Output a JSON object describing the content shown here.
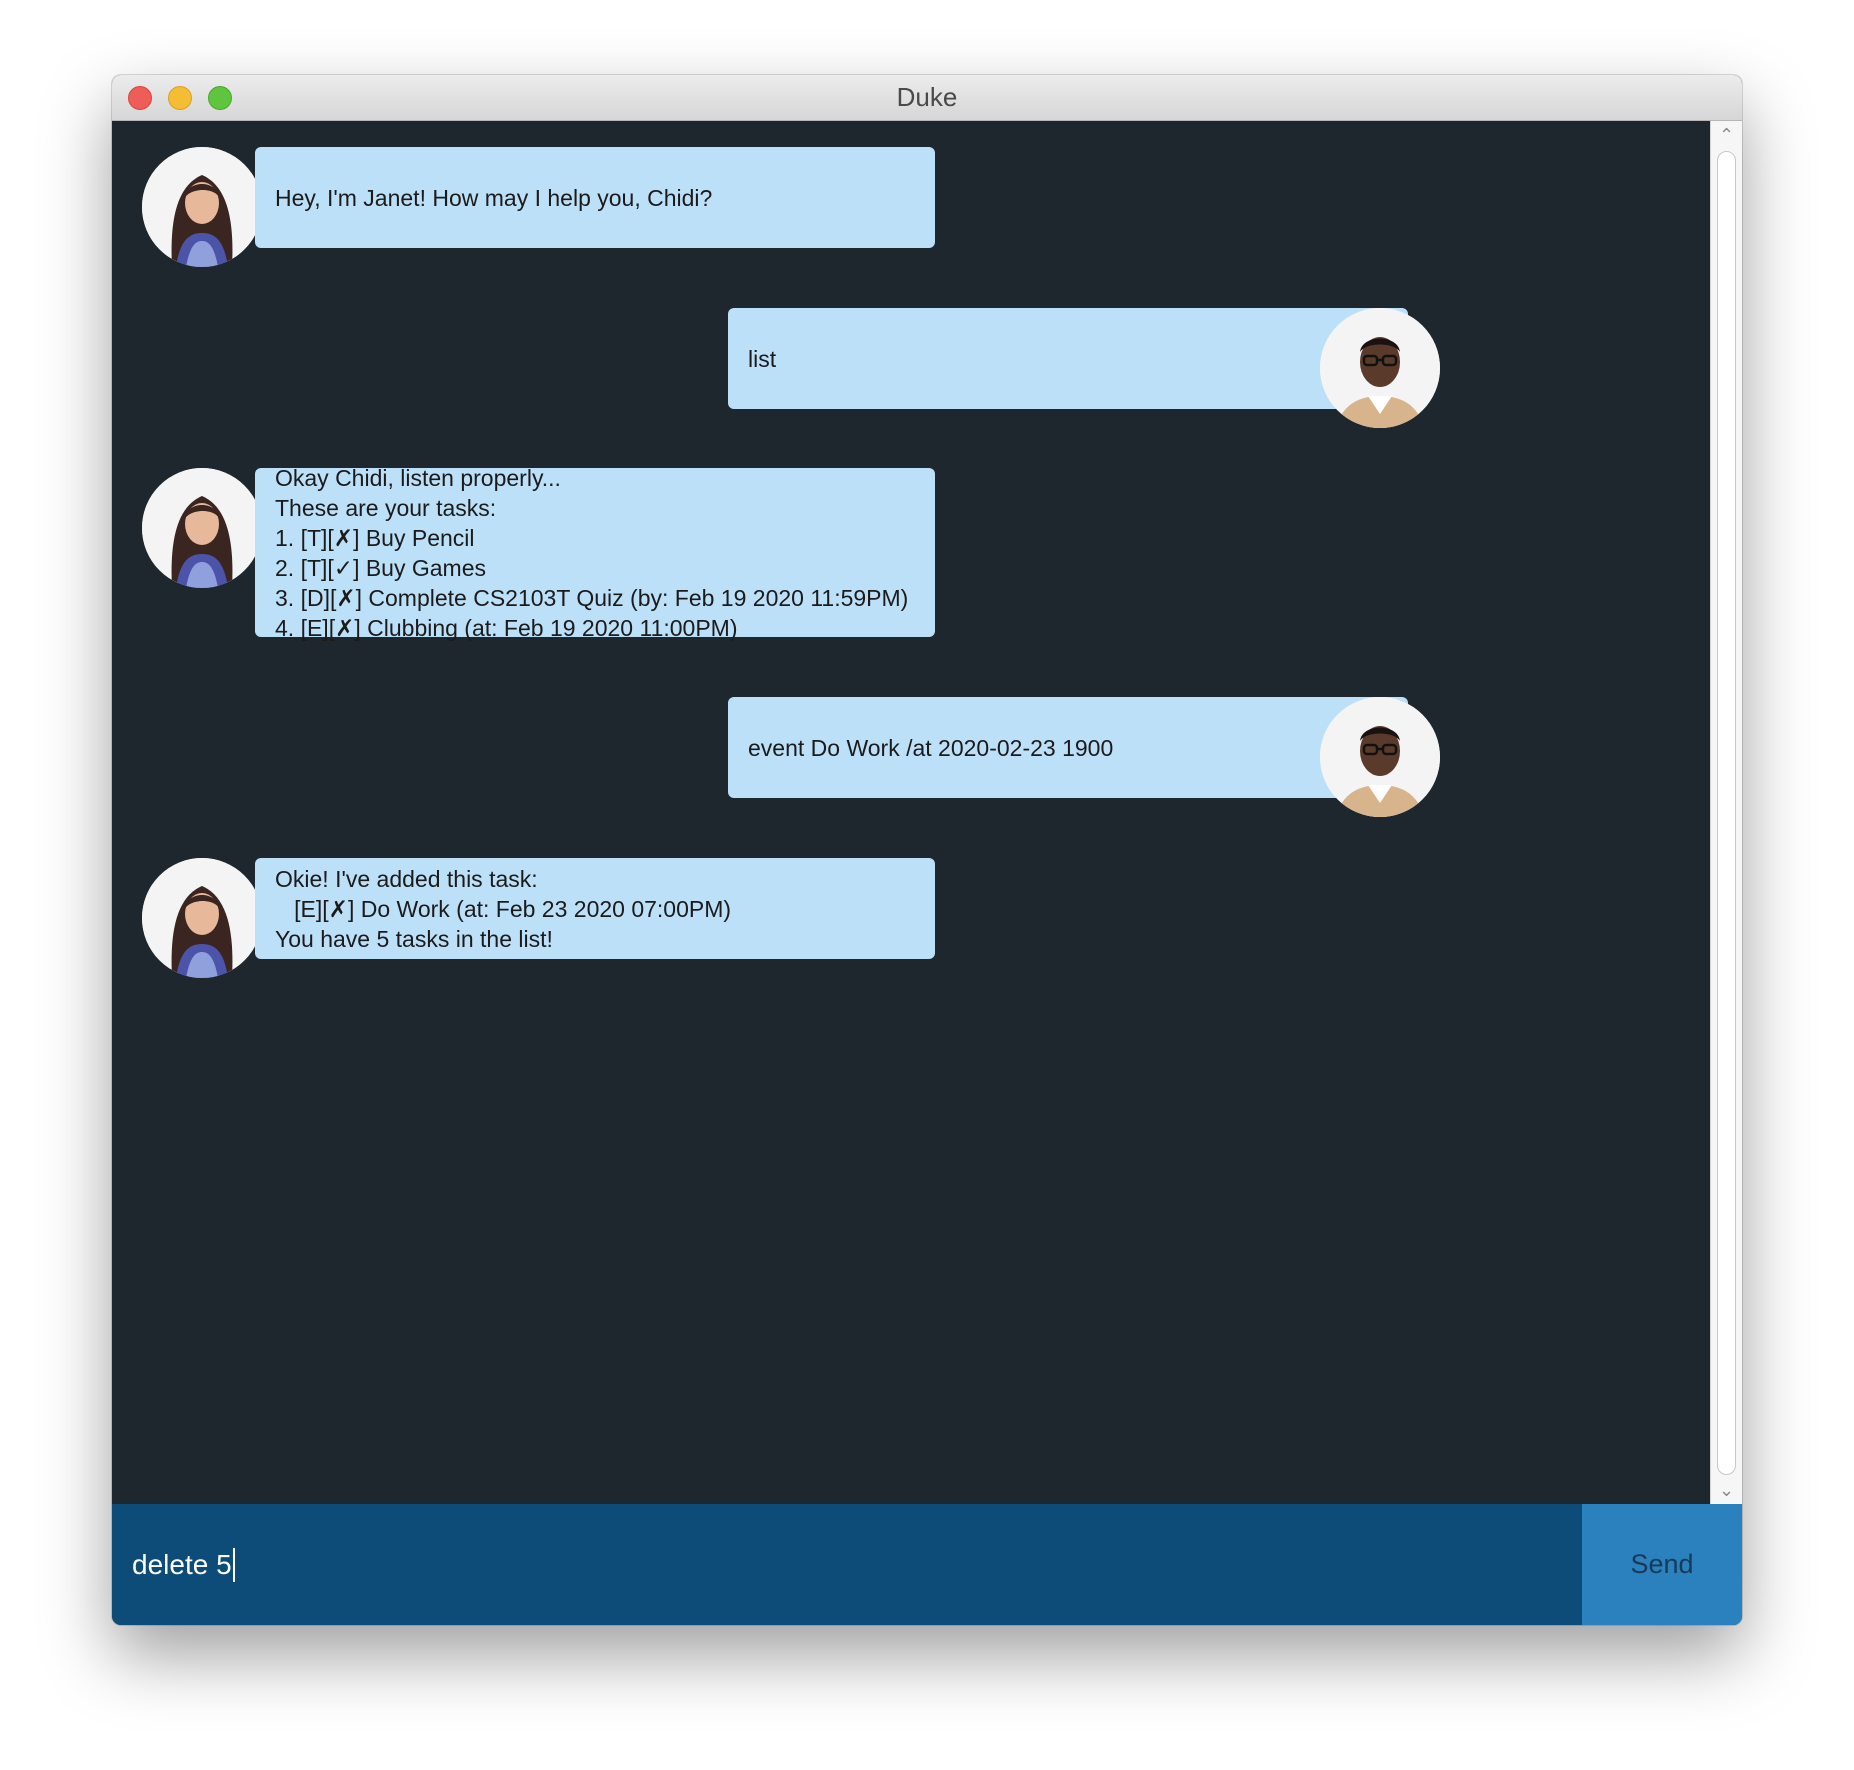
{
  "window": {
    "title": "Duke"
  },
  "messages": [
    {
      "sender": "janet",
      "text": "Hey, I'm Janet! How may I help you, Chidi?"
    },
    {
      "sender": "chidi",
      "text": "list"
    },
    {
      "sender": "janet",
      "text": "Okay Chidi, listen properly...\nThese are your tasks:\n1. [T][✗] Buy Pencil\n2. [T][✓] Buy Games\n3. [D][✗] Complete CS2103T Quiz (by: Feb 19 2020 11:59PM)\n4. [E][✗] Clubbing (at: Feb 19 2020 11:00PM)"
    },
    {
      "sender": "chidi",
      "text": "event Do Work /at 2020-02-23 1900"
    },
    {
      "sender": "janet",
      "text": "Okie! I've added this task:\n   [E][✗] Do Work (at: Feb 23 2020 07:00PM)\nYou have 5 tasks in the list!"
    }
  ],
  "input": {
    "value": "delete 5"
  },
  "send_button": {
    "label": "Send"
  },
  "colors": {
    "chat_background": "#1e272e",
    "bubble": "#bde0f9",
    "input_bar": "#0d4b78",
    "send_button": "#2b80be"
  },
  "icons": {
    "janet_avatar": "janet-avatar",
    "chidi_avatar": "chidi-avatar",
    "close": "close-window-icon",
    "minimize": "minimize-window-icon",
    "maximize": "maximize-window-icon"
  }
}
